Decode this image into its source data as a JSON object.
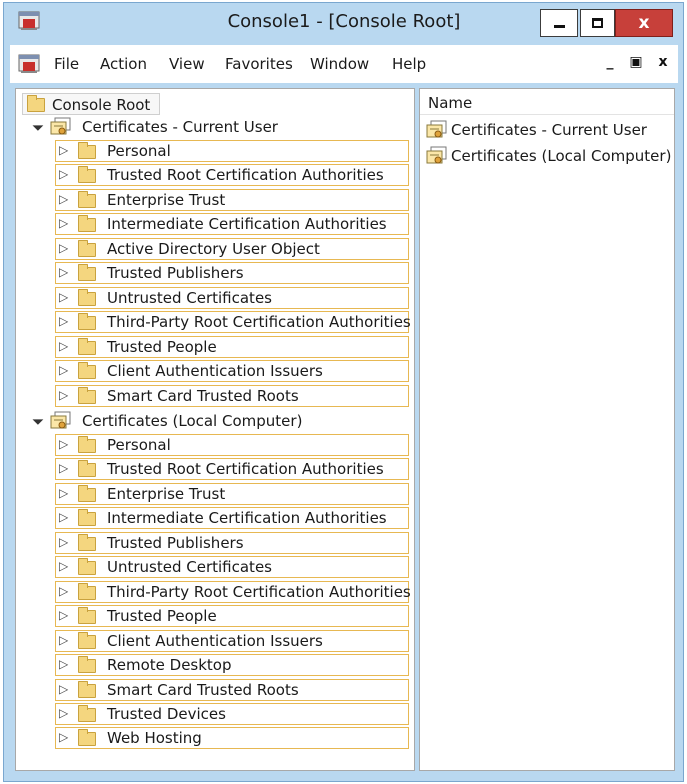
{
  "window": {
    "title": "Console1 - [Console Root]",
    "close_glyph": "x"
  },
  "menu": {
    "items": [
      "File",
      "Action",
      "View",
      "Favorites",
      "Window",
      "Help"
    ],
    "child_min": "_",
    "child_restore": "▣",
    "child_close": "x"
  },
  "tree": {
    "root": "Console Root",
    "current_user": {
      "label": "Certificates - Current User",
      "items": [
        "Personal",
        "Trusted Root Certification Authorities",
        "Enterprise Trust",
        "Intermediate Certification Authorities",
        "Active Directory User Object",
        "Trusted Publishers",
        "Untrusted Certificates",
        "Third-Party Root Certification Authorities",
        "Trusted People",
        "Client Authentication Issuers",
        "Smart Card Trusted Roots"
      ]
    },
    "local_computer": {
      "label": "Certificates (Local Computer)",
      "items": [
        "Personal",
        "Trusted Root Certification Authorities",
        "Enterprise Trust",
        "Intermediate Certification Authorities",
        "Trusted Publishers",
        "Untrusted Certificates",
        "Third-Party Root Certification Authorities",
        "Trusted People",
        "Client Authentication Issuers",
        "Remote Desktop",
        "Smart Card Trusted Roots",
        "Trusted Devices",
        "Web Hosting"
      ]
    }
  },
  "list": {
    "header": "Name",
    "rows": [
      "Certificates - Current User",
      "Certificates (Local Computer)"
    ]
  },
  "icons": {
    "app": "mmc-icon",
    "folder": "folder-icon",
    "snapin": "certificate-snapin-icon",
    "expanded": "expanded-arrow-icon",
    "collapsed": "collapsed-arrow-icon"
  },
  "colors": {
    "frame": "#b9d8f0",
    "close_button": "#c7403a",
    "tree_item_border": "#e7b852"
  }
}
